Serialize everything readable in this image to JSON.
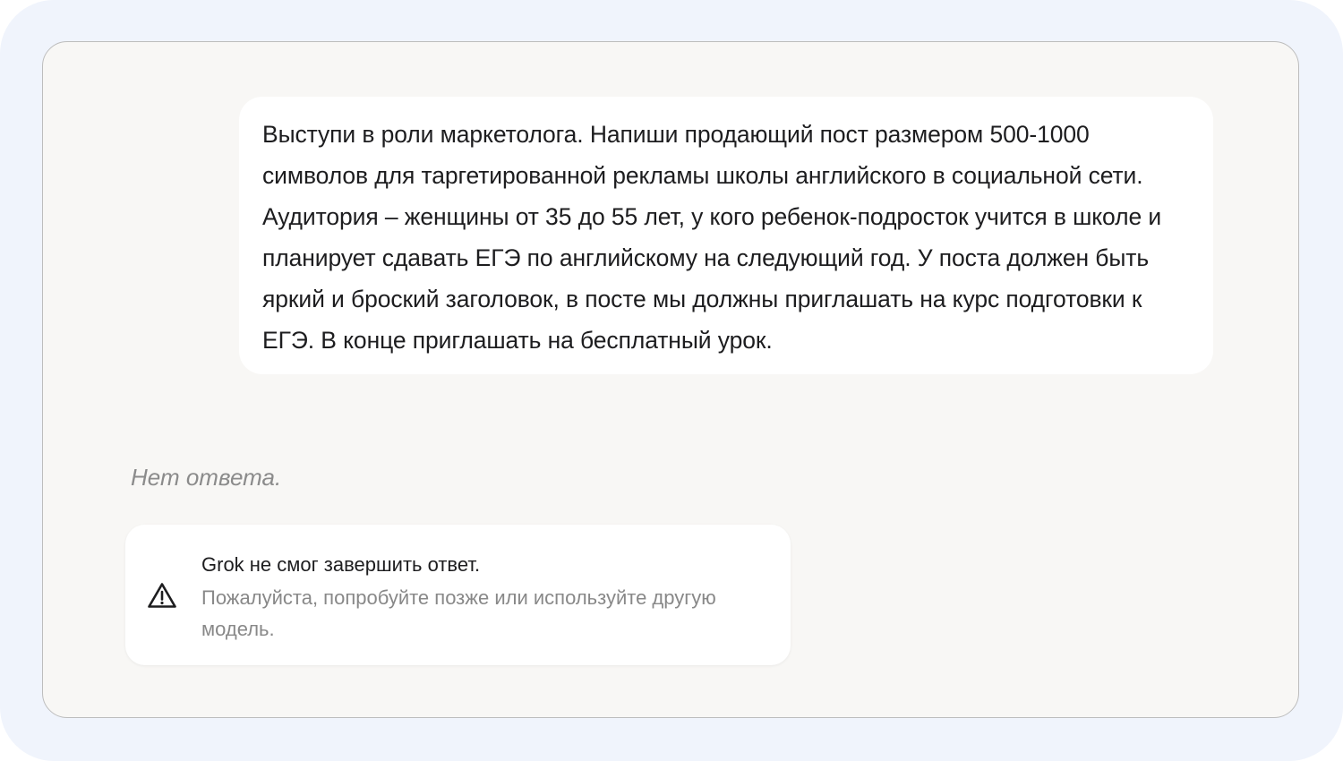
{
  "chat": {
    "user_message": "Выступи в роли маркетолога. Напиши продающий пост размером 500-1000 символов для таргетированной рекламы школы английского в социальной сети. Аудитория – женщины от 35 до 55 лет, у кого ребенок-подросток учится в школе и планирует сдавать ЕГЭ по английскому на следующий год. У поста должен быть яркий и броский заголовок, в посте мы должны приглашать на курс подготовки к ЕГЭ. В конце приглашать на бесплатный урок.",
    "no_answer_text": "Нет ответа.",
    "error": {
      "icon": "warning-icon",
      "title": "Grok не смог завершить ответ.",
      "subtitle": "Пожалуйста, попробуйте позже или используйте другую модель."
    }
  },
  "colors": {
    "outer_background": "#f0f4fc",
    "panel_background": "#f8f7f5",
    "bubble_background": "#ffffff",
    "muted_text": "#888888"
  }
}
